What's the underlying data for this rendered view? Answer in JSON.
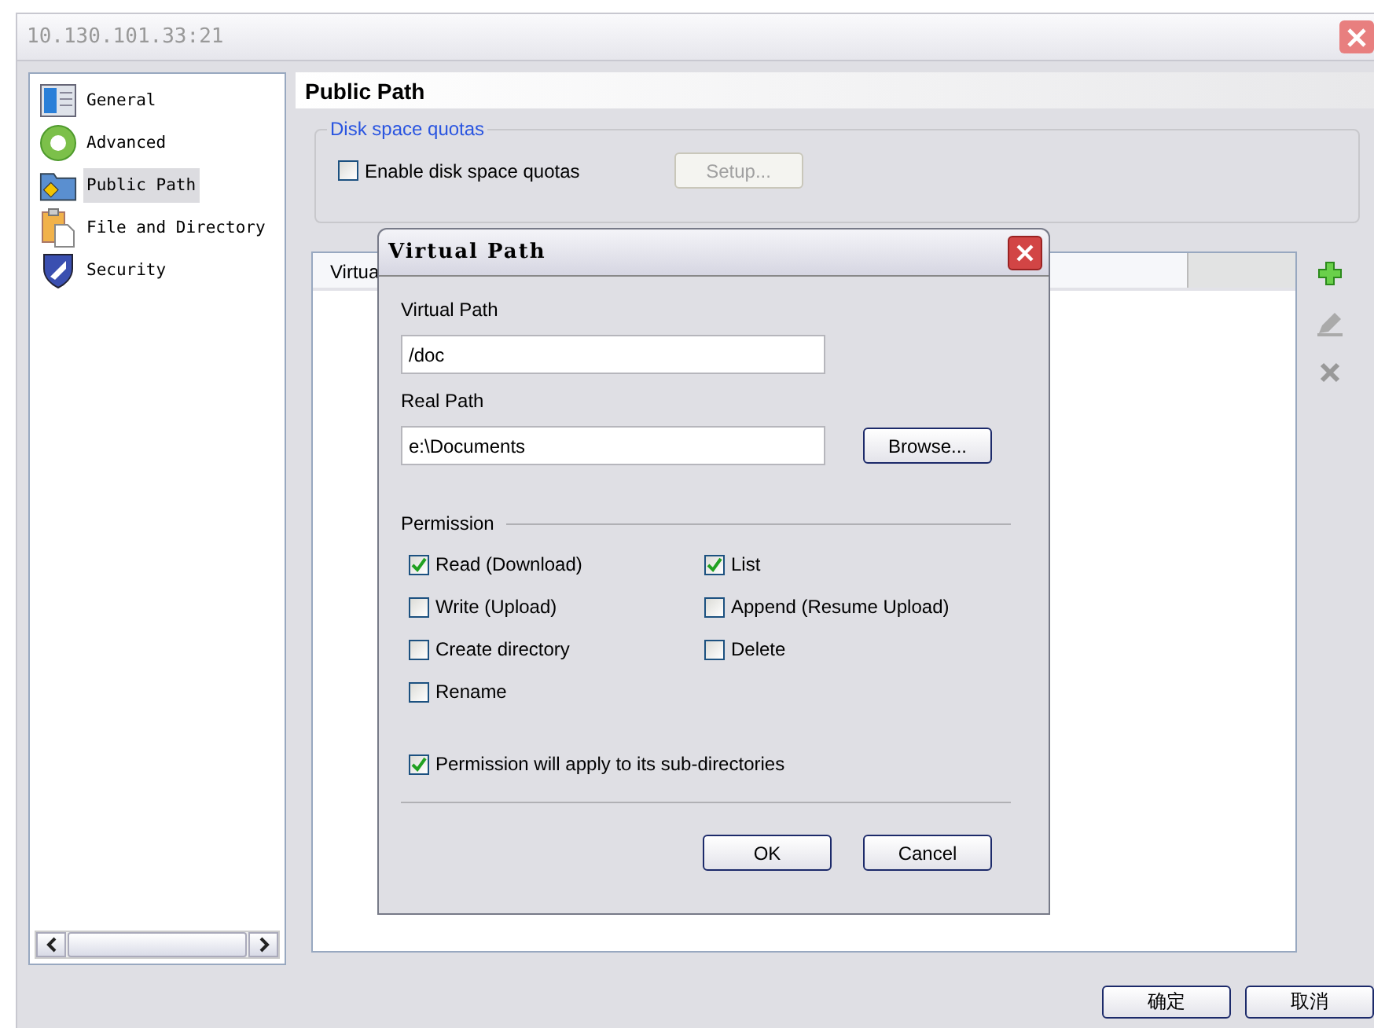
{
  "window": {
    "title": "10.130.101.33:21"
  },
  "sidebar": {
    "items": [
      {
        "label": "General",
        "selected": false
      },
      {
        "label": "Advanced",
        "selected": false
      },
      {
        "label": "Public Path",
        "selected": true
      },
      {
        "label": "File and Directory",
        "selected": false
      },
      {
        "label": "Security",
        "selected": false
      }
    ]
  },
  "page": {
    "title": "Public Path",
    "quota_group": {
      "legend": "Disk space quotas",
      "enable": {
        "label": "Enable disk space quotas",
        "checked": false
      },
      "setup_button": {
        "label": "Setup...",
        "disabled": true
      }
    },
    "table": {
      "columns": [
        "Virtua"
      ]
    }
  },
  "dialog": {
    "title": "Virtual Path",
    "virtual_path": {
      "label": "Virtual Path",
      "value": "/doc"
    },
    "real_path": {
      "label": "Real Path",
      "value": "e:\\Documents"
    },
    "browse_button": "Browse...",
    "permission_legend": "Permission",
    "permissions": [
      {
        "label": "Read (Download)",
        "checked": true
      },
      {
        "label": "List",
        "checked": true
      },
      {
        "label": "Write (Upload)",
        "checked": false
      },
      {
        "label": "Append (Resume Upload)",
        "checked": false
      },
      {
        "label": "Create directory",
        "checked": false
      },
      {
        "label": "Delete",
        "checked": false
      },
      {
        "label": "Rename",
        "checked": false
      }
    ],
    "apply_sub": {
      "label": "Permission will apply to its sub-directories",
      "checked": true
    },
    "buttons": [
      "OK",
      "Cancel"
    ]
  },
  "buttons": [
    "确定",
    "取消"
  ]
}
